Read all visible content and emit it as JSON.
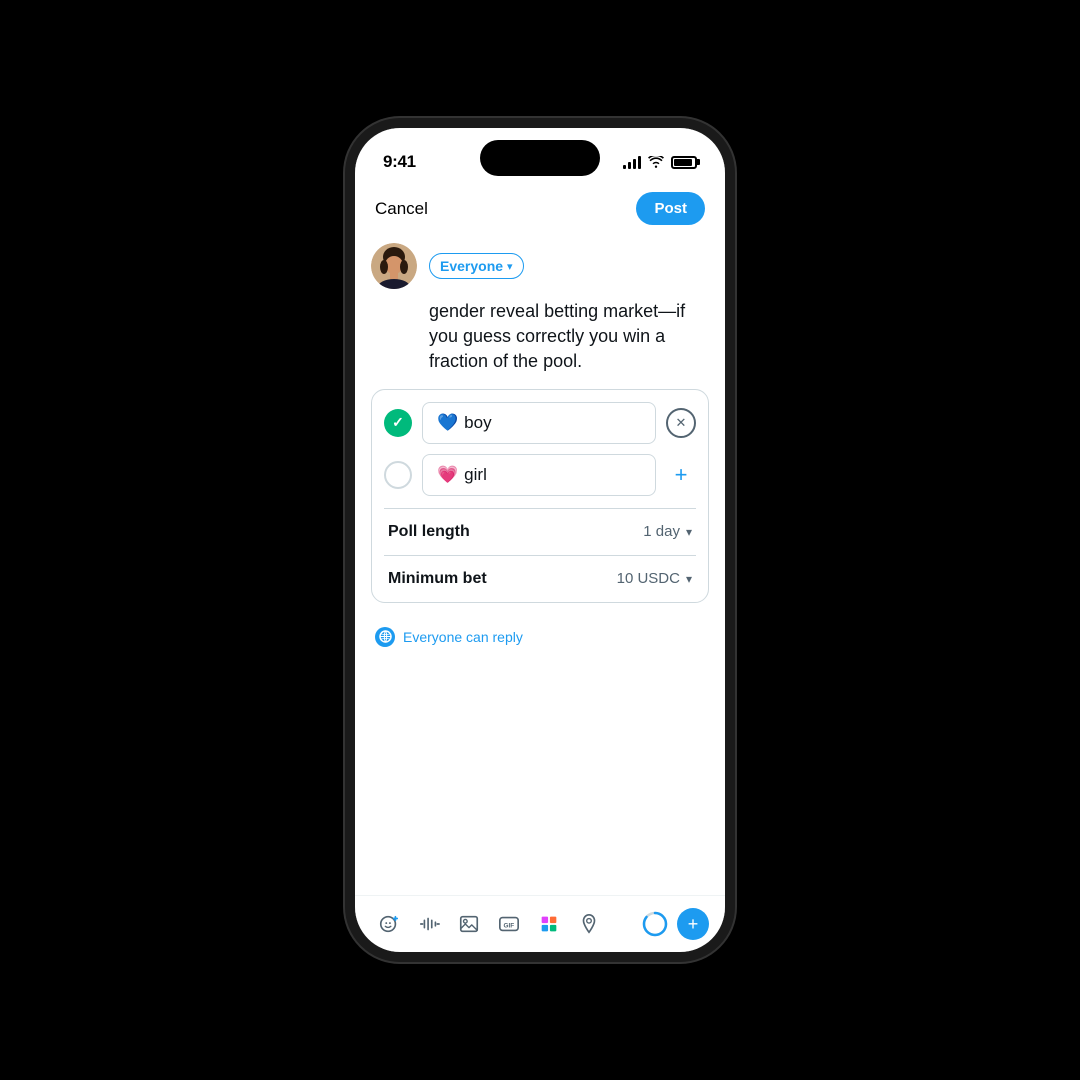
{
  "phone": {
    "time": "9:41"
  },
  "header": {
    "cancel_label": "Cancel",
    "post_label": "Post"
  },
  "composer": {
    "audience_label": "Everyone",
    "tweet_text": "gender reveal betting market—if you guess correctly you win a fraction of the pool."
  },
  "poll": {
    "option1_emoji": "💙",
    "option1_text": "boy",
    "option2_emoji": "💗",
    "option2_text": "girl",
    "poll_length_label": "Poll length",
    "poll_length_value": "1 day",
    "minimum_bet_label": "Minimum bet",
    "minimum_bet_value": "10 USDC"
  },
  "footer": {
    "everyone_can_reply": "Everyone can reply"
  },
  "toolbar": {
    "add_label": "+"
  }
}
